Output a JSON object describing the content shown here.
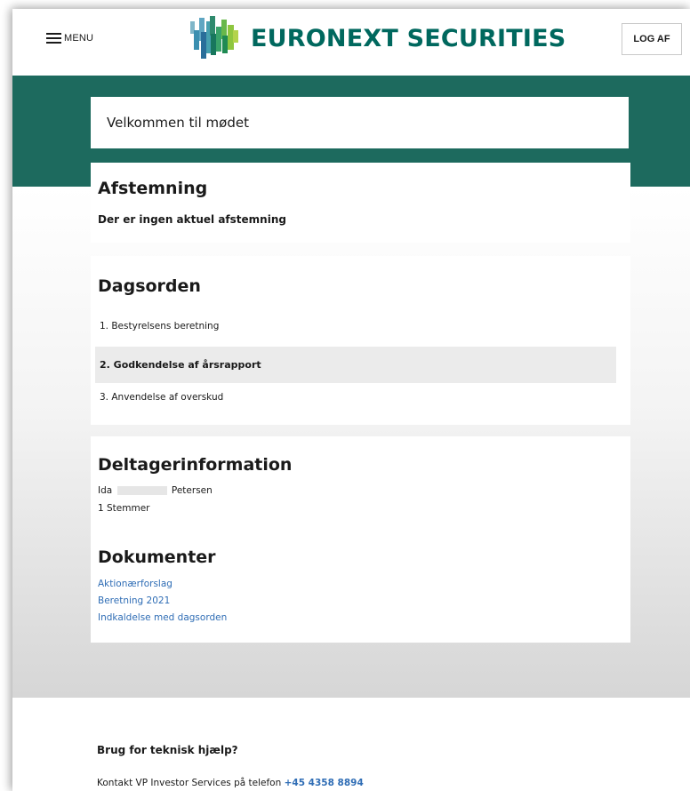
{
  "header": {
    "menu_label": "MENU",
    "logo_text": "EURONEXT SECURITIES",
    "logout_label": "LOG AF",
    "brand_color": "#00685e"
  },
  "welcome": {
    "text": "Velkommen til mødet"
  },
  "voting": {
    "title": "Afstemning",
    "message": "Der er ingen aktuel afstemning"
  },
  "agenda": {
    "title": "Dagsorden",
    "items": [
      {
        "label": "1. Bestyrelsens beretning",
        "active": false
      },
      {
        "label": "2. Godkendelse af årsrapport",
        "active": true
      },
      {
        "label": "3. Anvendelse af overskud",
        "active": false
      }
    ]
  },
  "participant": {
    "title": "Deltagerinformation",
    "first_name": "Ida",
    "last_name": "Petersen",
    "votes": "1 Stemmer"
  },
  "documents": {
    "title": "Dokumenter",
    "links": [
      "Aktionærforslag",
      "Beretning 2021",
      "Indkaldelse med dagsorden"
    ]
  },
  "footer": {
    "help_title": "Brug for teknisk hjælp?",
    "contact_text": "Kontakt VP Investor Services på telefon ",
    "phone": "+45 4358 8894"
  },
  "colors": {
    "band": "#1d6a5e",
    "link": "#2f6db5"
  }
}
